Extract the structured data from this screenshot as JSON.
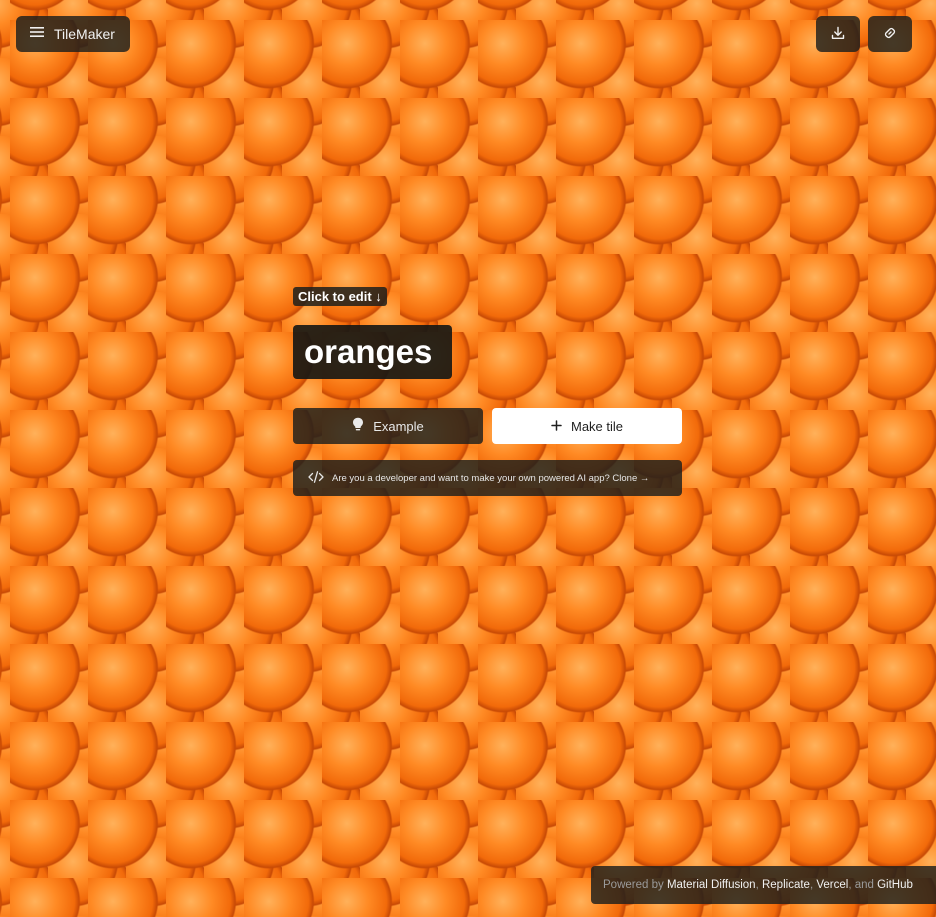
{
  "header": {
    "app_name": "TileMaker",
    "menu_icon": "hamburger-menu-icon",
    "download_icon": "download-icon",
    "link_icon": "link-icon"
  },
  "editor": {
    "hint": "Click to edit ↓",
    "prompt": "oranges"
  },
  "actions": {
    "example_label": "Example",
    "example_icon": "lightbulb-icon",
    "make_label": "Make tile",
    "make_icon": "plus-icon"
  },
  "developer_banner": {
    "icon": "code-icon",
    "text": "Are you a developer and want to make your own powered AI app? Clone →"
  },
  "footer": {
    "prefix": "Powered by",
    "links": [
      "Material Diffusion",
      "Replicate",
      "Vercel",
      "GitHub"
    ],
    "separator": ",",
    "and_word": "and"
  },
  "colors": {
    "orange": "#f26a0a",
    "leaf": "#2d5a27",
    "background": "#2b3029",
    "panel": "#1c1e1c",
    "make_button": "#ffffff"
  }
}
